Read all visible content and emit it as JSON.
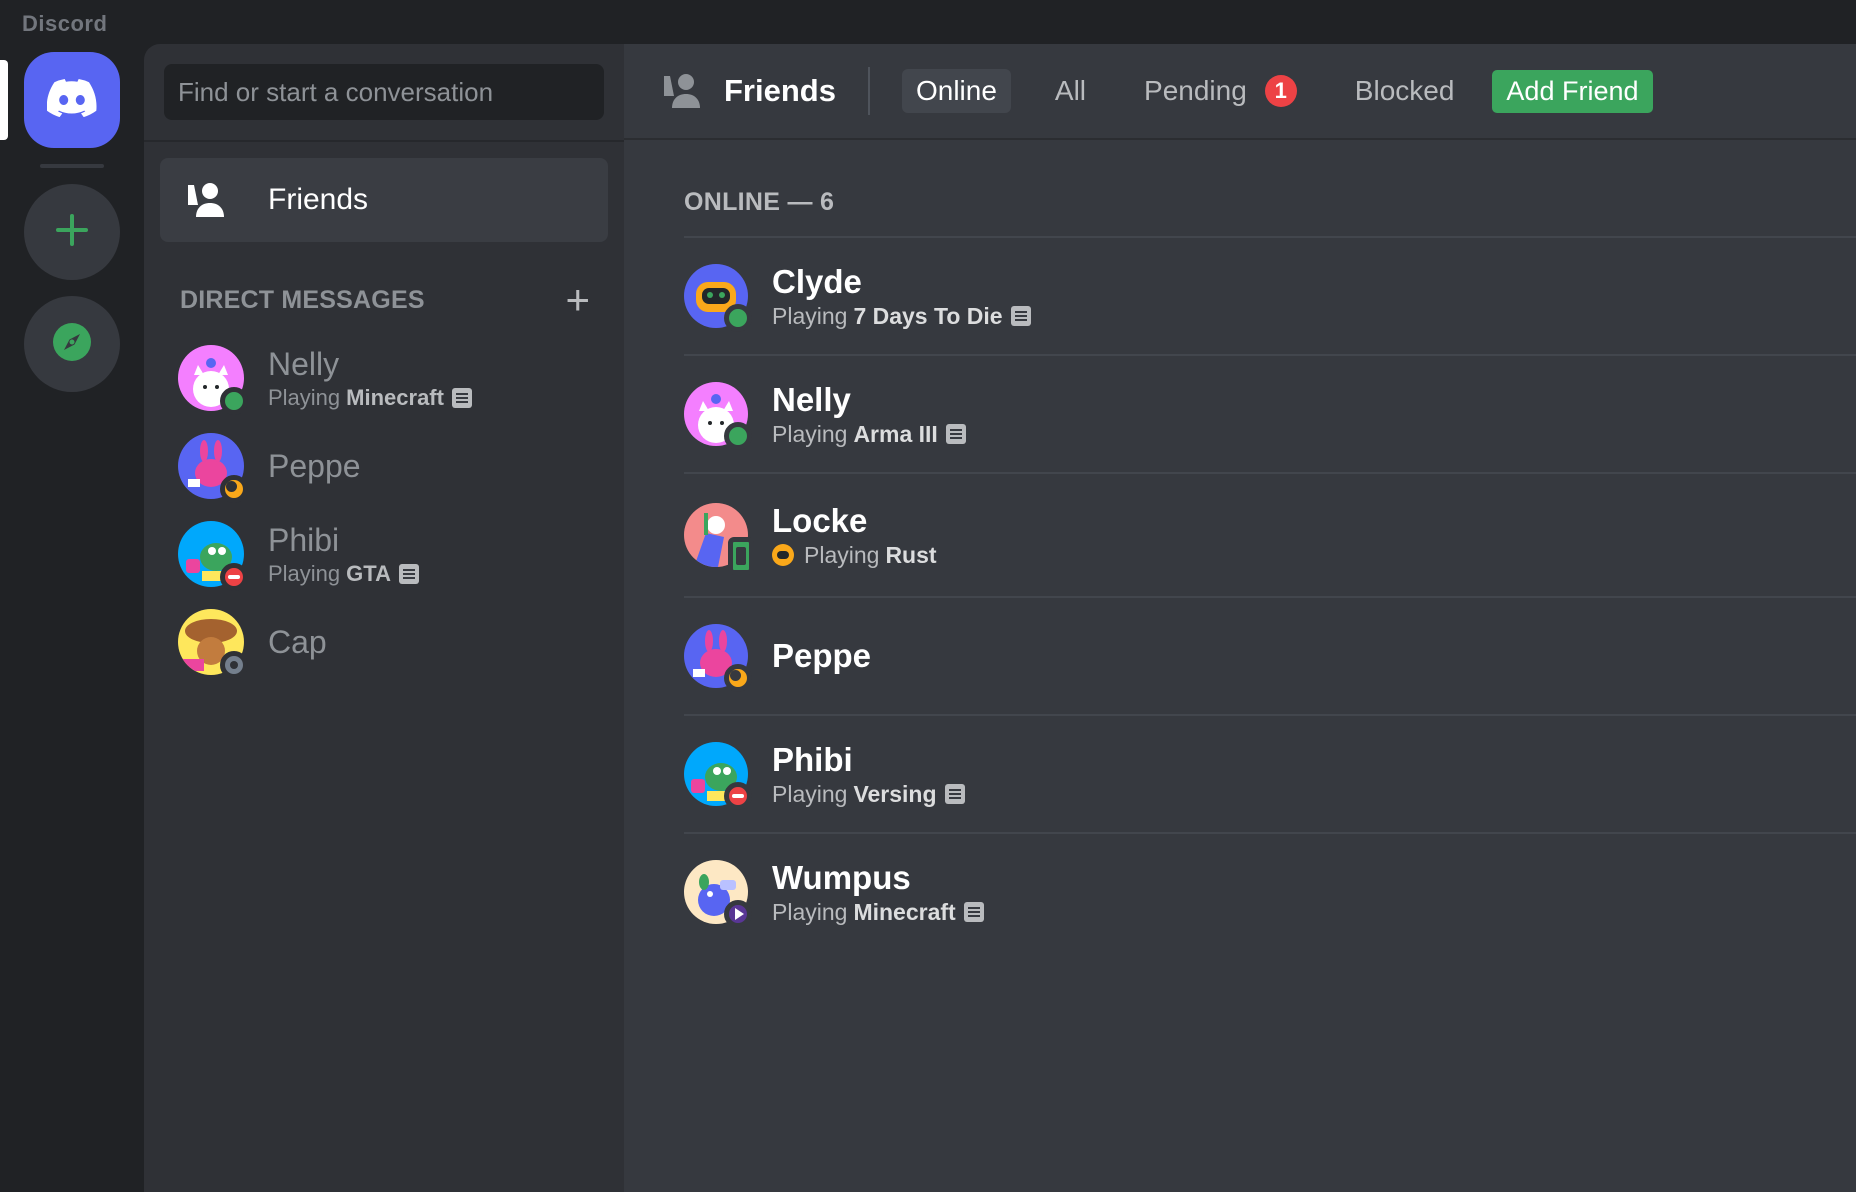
{
  "app": {
    "title": "Discord"
  },
  "search": {
    "placeholder": "Find or start a conversation"
  },
  "nav": {
    "friends_label": "Friends"
  },
  "direct_messages": {
    "header": "DIRECT MESSAGES",
    "items": [
      {
        "name": "Nelly",
        "status": "online",
        "activity_prefix": "Playing",
        "activity": "Minecraft"
      },
      {
        "name": "Peppe",
        "status": "idle",
        "activity_prefix": "",
        "activity": ""
      },
      {
        "name": "Phibi",
        "status": "dnd",
        "activity_prefix": "Playing",
        "activity": "GTA"
      },
      {
        "name": "Cap",
        "status": "offline",
        "activity_prefix": "",
        "activity": ""
      }
    ]
  },
  "topbar": {
    "title": "Friends",
    "tabs": {
      "online": "Online",
      "all": "All",
      "pending": "Pending",
      "blocked": "Blocked"
    },
    "pending_count": "1",
    "add_friend": "Add Friend"
  },
  "friends": {
    "header": "ONLINE — 6",
    "items": [
      {
        "name": "Clyde",
        "status": "online",
        "activity_prefix": "Playing",
        "activity": "7 Days To Die"
      },
      {
        "name": "Nelly",
        "status": "online",
        "activity_prefix": "Playing",
        "activity": "Arma III"
      },
      {
        "name": "Locke",
        "status": "mobile",
        "activity_prefix": "Playing",
        "activity": "Rust"
      },
      {
        "name": "Peppe",
        "status": "idle",
        "activity_prefix": "",
        "activity": ""
      },
      {
        "name": "Phibi",
        "status": "dnd",
        "activity_prefix": "Playing",
        "activity": "Versing"
      },
      {
        "name": "Wumpus",
        "status": "streaming",
        "activity_prefix": "Playing",
        "activity": "Minecraft"
      }
    ]
  },
  "colors": {
    "blurple": "#5865f2",
    "green": "#3ba55d",
    "red": "#ed4245",
    "idle": "#faa81a",
    "background": "#36393f",
    "sidebar": "#2f3136",
    "rail": "#202225"
  }
}
